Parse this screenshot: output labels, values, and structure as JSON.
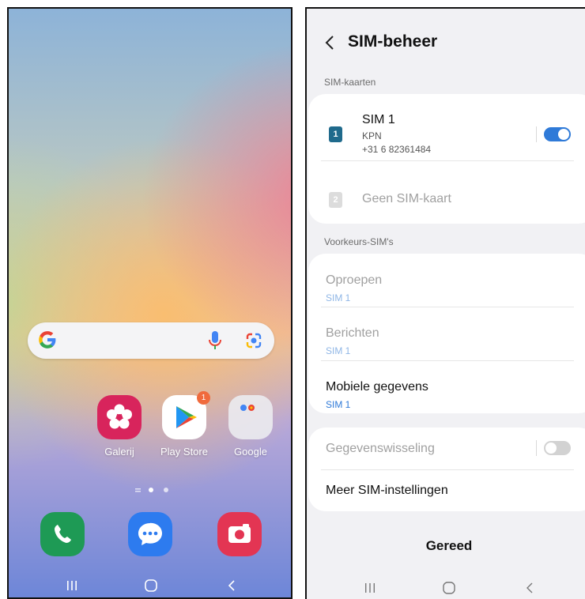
{
  "home": {
    "apps": [
      {
        "label": "Galerij",
        "icon": "gallery-flower-icon",
        "color": "#d8245c"
      },
      {
        "label": "Play Store",
        "icon": "play-store-icon",
        "color": "#ffffff",
        "badge": "1"
      },
      {
        "label": "Google",
        "icon": "google-folder-icon",
        "color": "#e6e6ea"
      }
    ],
    "dock": [
      {
        "icon": "phone-icon",
        "color": "#1e9a55"
      },
      {
        "icon": "messages-icon",
        "color": "#2d7bef"
      },
      {
        "icon": "camera-icon",
        "color": "#e33553"
      }
    ],
    "search_icons": [
      "google-g-icon",
      "microphone-icon",
      "google-lens-icon"
    ]
  },
  "sim": {
    "title": "SIM-beheer",
    "section_cards": "SIM-kaarten",
    "sim1": {
      "badge": "1",
      "name": "SIM 1",
      "carrier": "KPN",
      "number": "+31 6 82361484",
      "enabled": true
    },
    "sim2": {
      "badge": "2",
      "name": "Geen SIM-kaart"
    },
    "section_pref": "Voorkeurs-SIM's",
    "calls": {
      "title": "Oproepen",
      "value": "SIM 1"
    },
    "messages": {
      "title": "Berichten",
      "value": "SIM 1"
    },
    "mobile_data": {
      "title": "Mobiele gegevens",
      "value": "SIM 1"
    },
    "data_switch": {
      "title": "Gegevenswisseling",
      "enabled": false
    },
    "more": "Meer SIM-instellingen",
    "done": "Gereed"
  },
  "colors": {
    "accent": "#2f7ad8",
    "toggle_off": "#d2d2d2"
  }
}
